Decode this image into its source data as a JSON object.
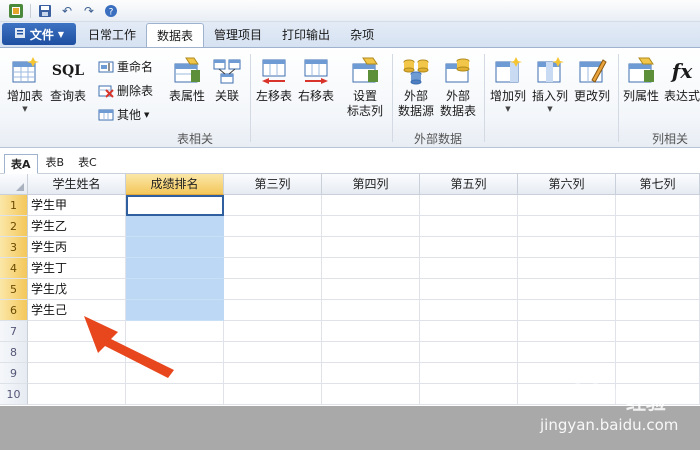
{
  "quick_access": {
    "icons": [
      "app-icon",
      "save-icon",
      "undo-icon",
      "redo-icon",
      "help-icon"
    ]
  },
  "tabbar": {
    "file_label": "文件",
    "tabs": [
      {
        "label": "日常工作",
        "active": false
      },
      {
        "label": "数据表",
        "active": true
      },
      {
        "label": "管理项目",
        "active": false
      },
      {
        "label": "打印输出",
        "active": false
      },
      {
        "label": "杂项",
        "active": false
      }
    ]
  },
  "ribbon": {
    "add_table": "增加表",
    "query_table": "查询表",
    "rename": "重命名",
    "delete_table": "删除表",
    "other": "其他",
    "table_props": "表属性",
    "link": "关联",
    "move_left": "左移表",
    "move_right": "右移表",
    "set_flag_col_1": "设置",
    "set_flag_col_2": "标志列",
    "ext_source_1": "外部",
    "ext_source_2": "数据源",
    "ext_table_1": "外部",
    "ext_table_2": "数据表",
    "add_col": "增加列",
    "insert_col": "插入列",
    "change_col": "更改列",
    "col_props": "列属性",
    "expression_col": "表达式",
    "group_table": "表相关",
    "group_external": "外部数据",
    "group_column": "列相关",
    "sql_label": "SQL",
    "fx_label": "fx"
  },
  "sheets": [
    {
      "label": "表A",
      "active": true
    },
    {
      "label": "表B",
      "active": false
    },
    {
      "label": "表C",
      "active": false
    }
  ],
  "grid": {
    "columns": [
      "学生姓名",
      "成绩排名",
      "第三列",
      "第四列",
      "第五列",
      "第六列",
      "第七列"
    ],
    "selected_column": 1,
    "row_numbers": [
      "1",
      "2",
      "3",
      "4",
      "5",
      "6",
      "7",
      "8",
      "9",
      "10"
    ],
    "selected_rows": 6,
    "names": [
      "学生甲",
      "学生乙",
      "学生丙",
      "学生丁",
      "学生戊",
      "学生己"
    ]
  },
  "watermark": {
    "logo": "Baidu",
    "text": "经验",
    "url": "jingyan.baidu.com"
  },
  "colors": {
    "accent": "#1e4fa1",
    "selection": "#bcd8f5",
    "header_selected": "#f3c75a",
    "arrow": "#e8461c"
  }
}
